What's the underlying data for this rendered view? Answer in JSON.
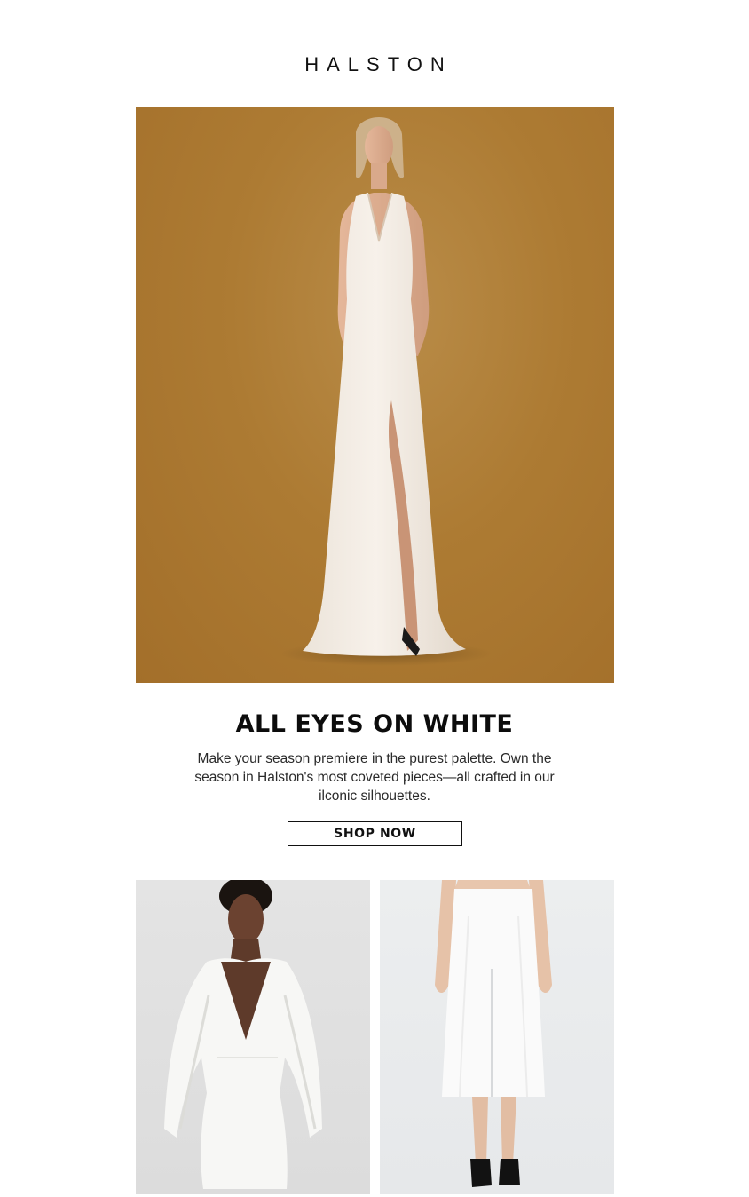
{
  "brand": {
    "logo_text": "HALSTON"
  },
  "hero": {
    "image_alt": "Model in white halter gown with thigh slit against amber backdrop",
    "bg_color": "#ad7b33"
  },
  "promo": {
    "headline": "ALL EYES ON WHITE",
    "body": "Make your season premiere in the purest palette. Own the season in Halston's most coveted pieces—all crafted in our ilconic silhouettes.",
    "cta_label": "SHOP NOW"
  },
  "products": [
    {
      "image_alt": "Model in white plunging cape mini dress"
    },
    {
      "image_alt": "Model in white high-waist midi skirt with front slit"
    }
  ]
}
